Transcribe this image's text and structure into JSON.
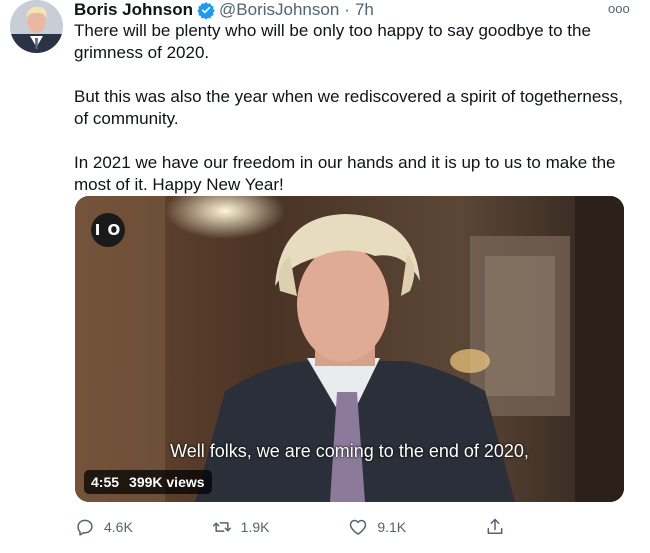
{
  "tweet": {
    "author_name": "Boris Johnson",
    "handle": "@BorisJohnson",
    "separator": "·",
    "time": "7h",
    "more": "ooo",
    "paragraphs": [
      "There will be plenty who will be only too happy to say goodbye to the grimness of 2020.",
      "But this was also the year when we rediscovered a spirit of togetherness, of community.",
      "In 2021 we have our freedom in our hands and it is up to us to make the most of it. Happy New Year!"
    ]
  },
  "video": {
    "logo": "I O",
    "caption": "Well folks, we are coming to the end of 2020,",
    "duration": "4:55",
    "views": "399K views"
  },
  "actions": {
    "replies": "4.6K",
    "retweets": "1.9K",
    "likes": "9.1K"
  },
  "colors": {
    "verified": "#1d9bf0",
    "secondary_text": "#536471"
  },
  "icons": [
    "verified-badge-icon",
    "more-icon",
    "reply-icon",
    "retweet-icon",
    "like-icon",
    "share-icon"
  ]
}
